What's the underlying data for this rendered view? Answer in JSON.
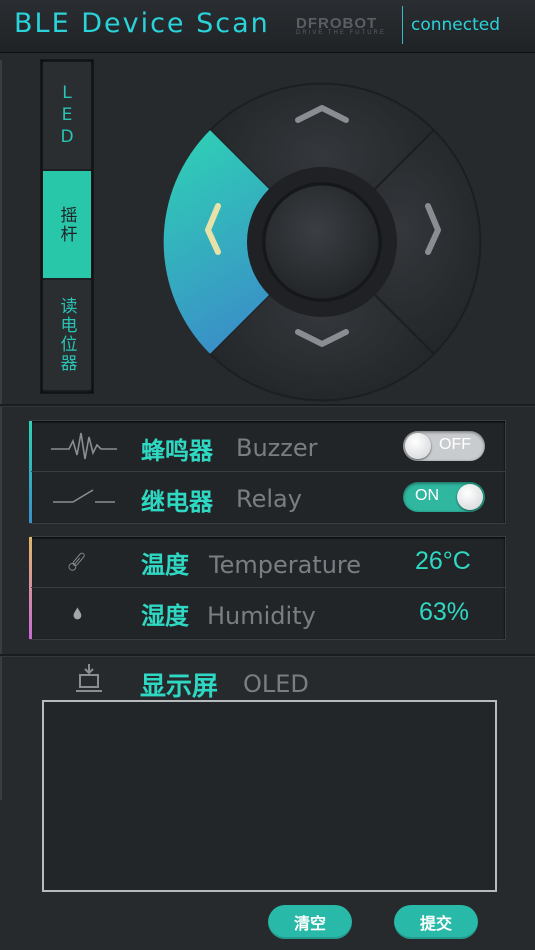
{
  "header": {
    "title": "BLE Device Scan",
    "brand_main": "DFROBOT",
    "brand_tag": "DRIVE THE FUTURE",
    "status": "connected"
  },
  "mode_tabs": {
    "items": [
      {
        "label": "LED",
        "active": false
      },
      {
        "label": "摇杆",
        "active": true
      },
      {
        "label": "读电位器",
        "active": false
      }
    ]
  },
  "dpad": {
    "active_direction": "left",
    "accent_color_from": "#2ed3b4",
    "accent_color_to": "#3a8ec8",
    "active_arrow_color": "#e7e3a8",
    "directions": [
      "up",
      "right",
      "down",
      "left"
    ]
  },
  "actuators": {
    "buzzer": {
      "label_cn": "蜂鸣器",
      "label_en": "Buzzer",
      "state": "OFF",
      "icon": "waveform-icon"
    },
    "relay": {
      "label_cn": "继电器",
      "label_en": "Relay",
      "state": "ON",
      "icon": "switch-icon"
    }
  },
  "sensors": {
    "temperature": {
      "label_cn": "温度",
      "label_en": "Temperature",
      "value": "26°C",
      "icon": "thermometer-icon"
    },
    "humidity": {
      "label_cn": "湿度",
      "label_en": "Humidity",
      "value": "63%",
      "icon": "droplet-icon"
    }
  },
  "oled": {
    "label_cn": "显示屏",
    "label_en": "OLED",
    "text": "",
    "icon": "download-display-icon"
  },
  "buttons": {
    "clear": "清空",
    "submit": "提交"
  },
  "colors": {
    "accent": "#2fd8c2",
    "header_text": "#29d3d9",
    "background": "#272a2d",
    "actuator_bar_from": "#2ed3b4",
    "actuator_bar_to": "#3a8ec8",
    "sensor_bar_from": "#e0b86a",
    "sensor_bar_to": "#c86ad8"
  }
}
